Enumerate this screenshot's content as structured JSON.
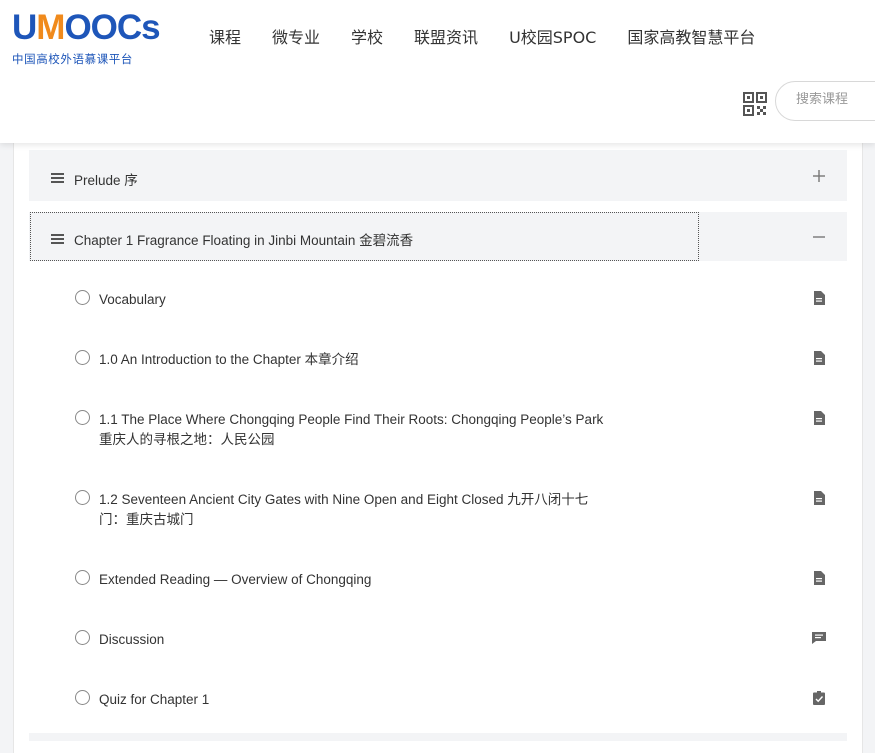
{
  "header": {
    "logo_text_1": "U",
    "logo_text_2": "M",
    "logo_text_3": "OOCs",
    "logo_subtitle": "中国高校外语慕课平台",
    "nav": [
      "课程",
      "微专业",
      "学校",
      "联盟资讯",
      "U校园SPOC",
      "国家高教智慧平台"
    ],
    "search_placeholder": "搜索课程",
    "qr_icon": "qr-code-icon"
  },
  "colors": {
    "brand_blue": "#1e56b9",
    "brand_orange": "#f08a1c",
    "chapter_bg": "#f3f4f6"
  },
  "chapters": [
    {
      "title": "Prelude 序",
      "expanded": false,
      "toggle": "plus-icon"
    },
    {
      "title": "Chapter 1 Fragrance Floating in Jinbi Mountain 金碧流香",
      "expanded": true,
      "toggle": "minus-icon"
    }
  ],
  "lessons": [
    {
      "title": "Vocabulary",
      "icon": "document-icon"
    },
    {
      "title": "1.0 An Introduction to the Chapter 本章介绍",
      "icon": "document-icon"
    },
    {
      "title": "1.1 The Place Where Chongqing People Find Their Roots: Chongqing People’s Park 重庆人的寻根之地：人民公园",
      "icon": "document-icon"
    },
    {
      "title": "1.2 Seventeen Ancient City Gates with Nine Open and Eight Closed 九开八闭十七门：重庆古城门",
      "icon": "document-icon"
    },
    {
      "title": "Extended Reading — Overview of Chongqing",
      "icon": "document-icon"
    },
    {
      "title": "Discussion",
      "icon": "chat-icon"
    },
    {
      "title": "Quiz for Chapter 1",
      "icon": "quiz-check-icon"
    }
  ]
}
